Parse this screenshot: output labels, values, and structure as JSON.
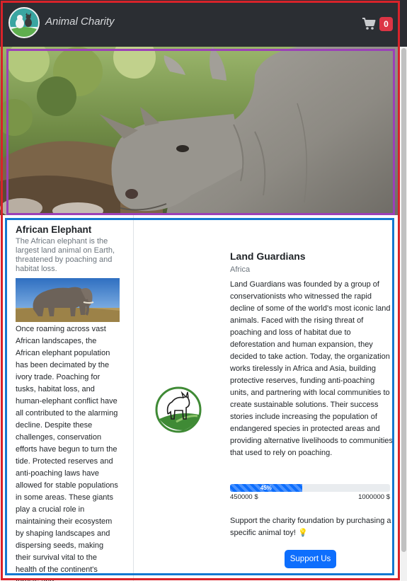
{
  "navbar": {
    "brand": "Animal Charity",
    "cart_count": "0",
    "cart_icon": "shopping-cart-icon",
    "logo_icon": "animal-charity-logo"
  },
  "hero": {
    "image_icon": "rhinoceros-photo"
  },
  "animal": {
    "name": "African Elephant",
    "tagline": "The African elephant is the largest land animal on Earth, threatened by poaching and habitat loss.",
    "image_icon": "elephant-photo",
    "description": "Once roaming across vast African landscapes, the African elephant population has been decimated by the ivory trade. Poaching for tusks, habitat loss, and human-elephant conflict have all contributed to the alarming decline. Despite these challenges, conservation efforts have begun to turn the tide. Protected reserves and anti-poaching laws have allowed for stable populations in some areas. These giants play a crucial role in maintaining their ecosystem by shaping landscapes and dispersing seeds, making their survival vital to the health of the continent's forests and"
  },
  "organization": {
    "logo_icon": "land-guardians-logo",
    "name": "Land Guardians",
    "region": "Africa",
    "description": "Land Guardians was founded by a group of conservationists who witnessed the rapid decline of some of the world's most iconic land animals. Faced with the rising threat of poaching and loss of habitat due to deforestation and human expansion, they decided to take action. Today, the organization works tirelessly in Africa and Asia, building protective reserves, funding anti-poaching units, and partnering with local communities to create sustainable solutions. Their success stories include increasing the population of endangered species in protected areas and providing alternative livelihoods to communities that used to rely on poaching."
  },
  "funding": {
    "progress_percent": 45,
    "progress_label": "45%",
    "raised": "450000 $",
    "goal": "1000000 $"
  },
  "support": {
    "text": "Support the charity foundation by purchasing a specific animal toy! 💡",
    "button_label": "Support Us"
  },
  "colors": {
    "navbar_bg": "#2b2e33",
    "primary": "#0d6efd",
    "badge": "#dc3545",
    "annotation_red": "#d8232a",
    "annotation_purple": "#9b40b8",
    "annotation_blue": "#1378d1"
  }
}
